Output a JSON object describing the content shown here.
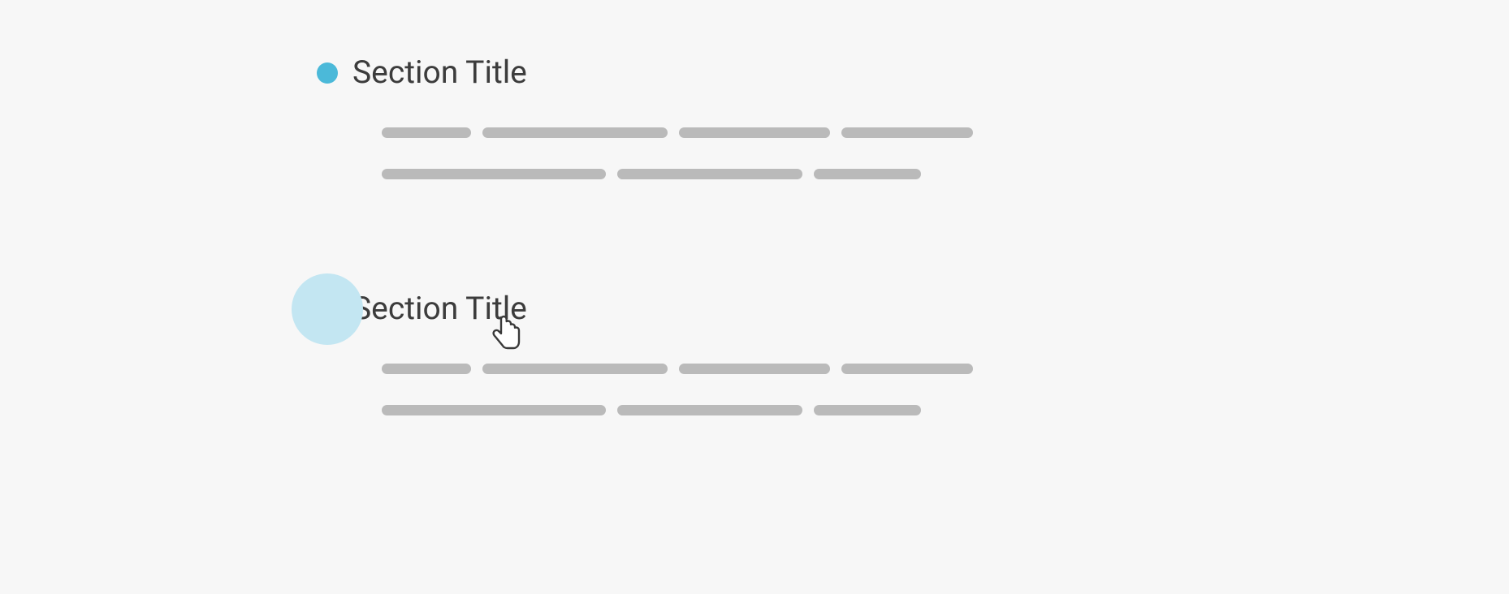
{
  "sections": [
    {
      "title": "Section Title",
      "state": "default"
    },
    {
      "title": "Section Title",
      "state": "hover"
    }
  ],
  "colors": {
    "bullet_solid": "#4bb9d9",
    "bullet_hover_bg": "#c3e6f2",
    "placeholder": "#bababa",
    "text": "#3c3c3c",
    "page_bg": "#f7f7f7"
  }
}
